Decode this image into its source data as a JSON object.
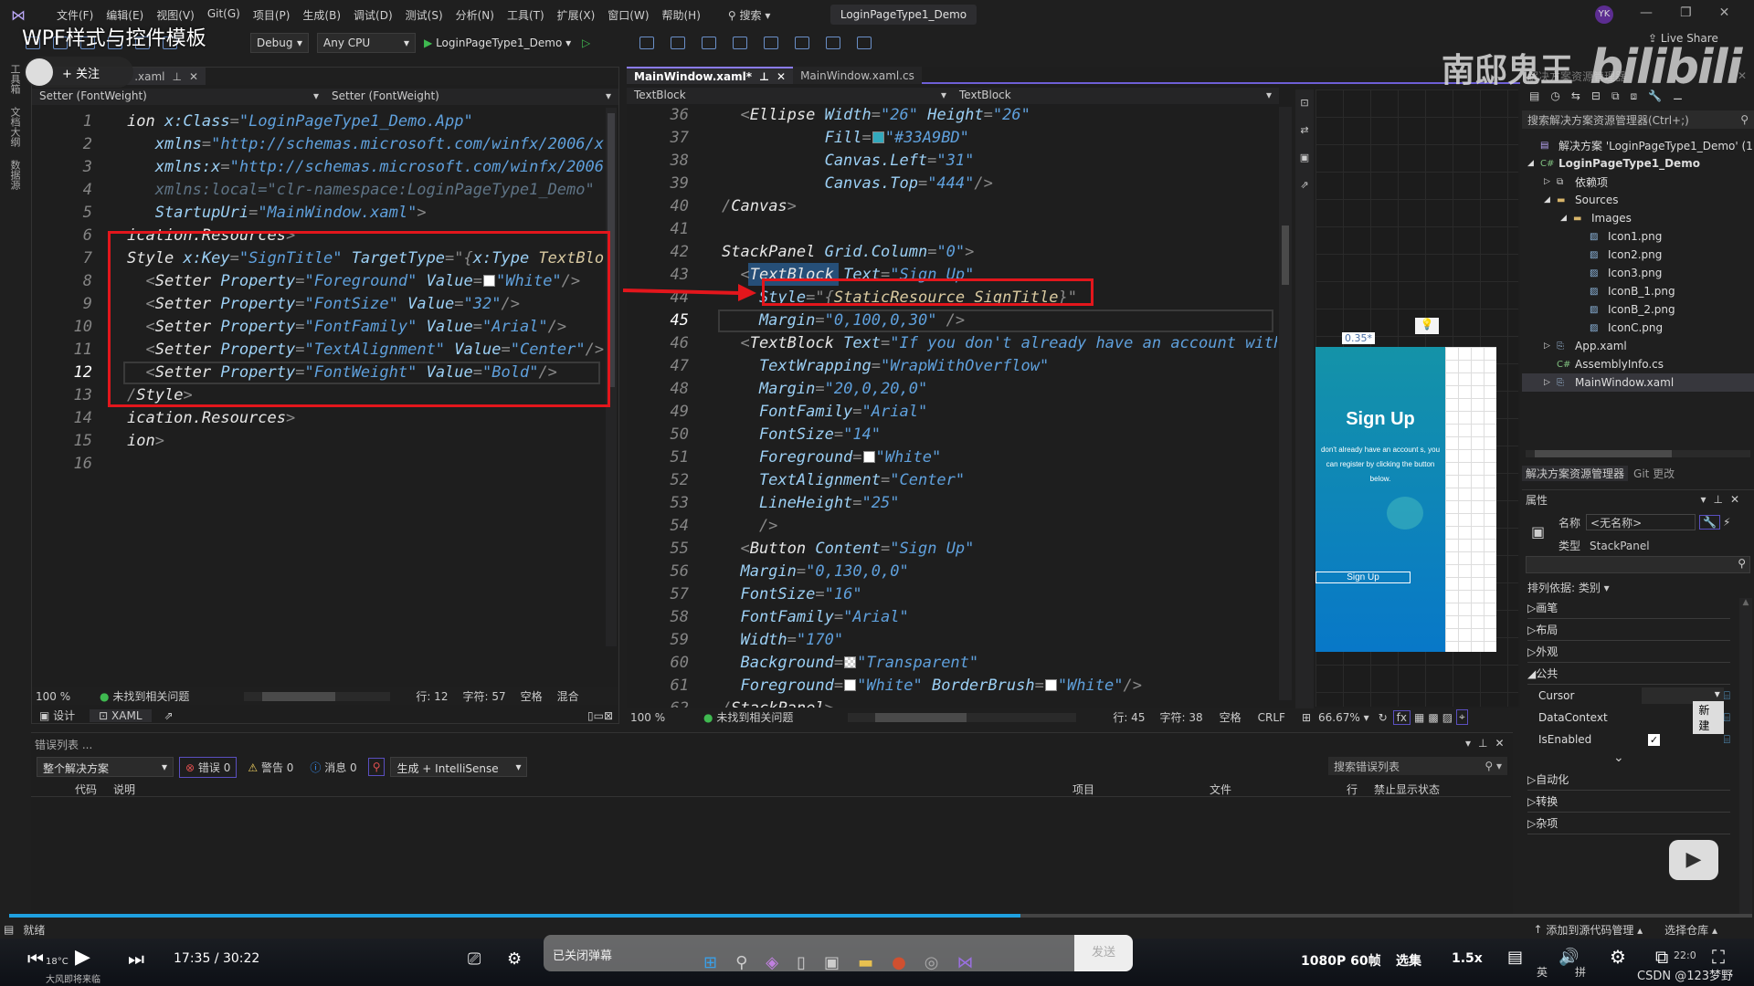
{
  "overlay": {
    "video_title": "WPF样式与控件模板",
    "follow": "+ 关注",
    "watermark_cn": "南邸鬼王",
    "watermark_logo": "bilibili",
    "csdn": "CSDN @123梦野"
  },
  "menubar": {
    "items": [
      "文件(F)",
      "编辑(E)",
      "视图(V)",
      "Git(G)",
      "项目(P)",
      "生成(B)",
      "调试(D)",
      "测试(S)",
      "分析(N)",
      "工具(T)",
      "扩展(X)",
      "窗口(W)",
      "帮助(H)"
    ],
    "search": "搜索",
    "title": "LoginPageType1_Demo",
    "user": "YK",
    "live_share": "Live Share"
  },
  "toolbar": {
    "config": "Debug",
    "platform": "Any CPU",
    "run_target": "LoginPageType1_Demo"
  },
  "left_strip": [
    "工具箱",
    "文档大纲",
    "数据源"
  ],
  "left_editor": {
    "tab": ".xaml",
    "nav": [
      "Setter (FontWeight)",
      "Setter (FontWeight)"
    ],
    "current_line": 12,
    "lines": [
      {
        "n": 1,
        "tokens": [
          [
            "t",
            "ion "
          ],
          [
            "a",
            "x:Class"
          ],
          [
            "p",
            "="
          ],
          [
            "v",
            "\"LoginPageType1_Demo.App\""
          ]
        ]
      },
      {
        "n": 2,
        "tokens": [
          [
            "a",
            "   xmlns"
          ],
          [
            "p",
            "="
          ],
          [
            "v",
            "\"http://schemas.microsoft.com/winfx/2006/xa"
          ]
        ]
      },
      {
        "n": 3,
        "tokens": [
          [
            "a",
            "   xmlns:x"
          ],
          [
            "p",
            "="
          ],
          [
            "v",
            "\"http://schemas.microsoft.com/winfx/2006/"
          ]
        ]
      },
      {
        "n": 4,
        "tokens": [
          [
            "g",
            "   xmlns:local=\"clr-namespace:LoginPageType1_Demo\""
          ]
        ]
      },
      {
        "n": 5,
        "tokens": [
          [
            "a",
            "   StartupUri"
          ],
          [
            "p",
            "="
          ],
          [
            "v",
            "\"MainWindow.xaml\""
          ],
          [
            "p",
            ">"
          ]
        ]
      },
      {
        "n": 6,
        "tokens": [
          [
            "t",
            "ication.Resources"
          ],
          [
            "p",
            ">"
          ]
        ]
      },
      {
        "n": 7,
        "tokens": [
          [
            "t",
            "Style "
          ],
          [
            "a",
            "x:Key"
          ],
          [
            "p",
            "="
          ],
          [
            "v",
            "\"SignTitle\" "
          ],
          [
            "a",
            "TargetType"
          ],
          [
            "p",
            "=\"{"
          ],
          [
            "a",
            "x:Type "
          ],
          [
            "k",
            "TextBlock"
          ]
        ]
      },
      {
        "n": 8,
        "tokens": [
          [
            "p",
            "  <"
          ],
          [
            "t",
            "Setter "
          ],
          [
            "a",
            "Property"
          ],
          [
            "p",
            "="
          ],
          [
            "v",
            "\"Foreground\" "
          ],
          [
            "a",
            "Value"
          ],
          [
            "p",
            "="
          ],
          [
            "s",
            "#FFFFFF"
          ],
          [
            "v",
            "\"White\""
          ],
          [
            "p",
            "/>"
          ]
        ]
      },
      {
        "n": 9,
        "tokens": [
          [
            "p",
            "  <"
          ],
          [
            "t",
            "Setter "
          ],
          [
            "a",
            "Property"
          ],
          [
            "p",
            "="
          ],
          [
            "v",
            "\"FontSize\" "
          ],
          [
            "a",
            "Value"
          ],
          [
            "p",
            "="
          ],
          [
            "v",
            "\"32\""
          ],
          [
            "p",
            "/>"
          ]
        ]
      },
      {
        "n": 10,
        "tokens": [
          [
            "p",
            "  <"
          ],
          [
            "t",
            "Setter "
          ],
          [
            "a",
            "Property"
          ],
          [
            "p",
            "="
          ],
          [
            "v",
            "\"FontFamily\" "
          ],
          [
            "a",
            "Value"
          ],
          [
            "p",
            "="
          ],
          [
            "v",
            "\"Arial\""
          ],
          [
            "p",
            "/>"
          ]
        ]
      },
      {
        "n": 11,
        "tokens": [
          [
            "p",
            "  <"
          ],
          [
            "t",
            "Setter "
          ],
          [
            "a",
            "Property"
          ],
          [
            "p",
            "="
          ],
          [
            "v",
            "\"TextAlignment\" "
          ],
          [
            "a",
            "Value"
          ],
          [
            "p",
            "="
          ],
          [
            "v",
            "\"Center\""
          ],
          [
            "p",
            "/>"
          ]
        ]
      },
      {
        "n": 12,
        "tokens": [
          [
            "p",
            "  <"
          ],
          [
            "t",
            "Setter "
          ],
          [
            "a",
            "Property"
          ],
          [
            "p",
            "="
          ],
          [
            "v",
            "\"FontWeight\" "
          ],
          [
            "a",
            "Value"
          ],
          [
            "p",
            "="
          ],
          [
            "v",
            "\"Bold\""
          ],
          [
            "p",
            "/>"
          ]
        ]
      },
      {
        "n": 13,
        "tokens": [
          [
            "p",
            "/"
          ],
          [
            "t",
            "Style"
          ],
          [
            "p",
            ">"
          ]
        ]
      },
      {
        "n": 14,
        "tokens": [
          [
            "t",
            "ication.Resources"
          ],
          [
            "p",
            ">"
          ]
        ]
      },
      {
        "n": 15,
        "tokens": [
          [
            "t",
            "ion"
          ],
          [
            "p",
            ">"
          ]
        ]
      },
      {
        "n": 16,
        "tokens": []
      }
    ],
    "status": {
      "zoom": "100 %",
      "issues": "未找到相关问题",
      "line": "行: 12",
      "char": "字符: 57",
      "spaces": "空格",
      "eol": "混合"
    },
    "view_tabs": {
      "design": "设计",
      "xaml": "XAML"
    }
  },
  "right_editor": {
    "tabs": [
      {
        "label": "MainWindow.xaml*",
        "active": true
      },
      {
        "label": "MainWindow.xaml.cs",
        "active": false
      }
    ],
    "nav": [
      "TextBlock",
      "TextBlock"
    ],
    "current_line": 45,
    "lines": [
      {
        "n": 36,
        "tokens": [
          [
            "p",
            "  <"
          ],
          [
            "t",
            "Ellipse "
          ],
          [
            "a",
            "Width"
          ],
          [
            "p",
            "="
          ],
          [
            "v",
            "\"26\" "
          ],
          [
            "a",
            "Height"
          ],
          [
            "p",
            "="
          ],
          [
            "v",
            "\"26\""
          ]
        ]
      },
      {
        "n": 37,
        "tokens": [
          [
            "a",
            "           Fill"
          ],
          [
            "p",
            "="
          ],
          [
            "s",
            "#33A9BD"
          ],
          [
            "v",
            "\"#33A9BD\""
          ]
        ]
      },
      {
        "n": 38,
        "tokens": [
          [
            "a",
            "           Canvas.Left"
          ],
          [
            "p",
            "="
          ],
          [
            "v",
            "\"31\""
          ]
        ]
      },
      {
        "n": 39,
        "tokens": [
          [
            "a",
            "           Canvas.Top"
          ],
          [
            "p",
            "="
          ],
          [
            "v",
            "\"444\""
          ],
          [
            "p",
            "/>"
          ]
        ]
      },
      {
        "n": 40,
        "tokens": [
          [
            "p",
            "/"
          ],
          [
            "t",
            "Canvas"
          ],
          [
            "p",
            ">"
          ]
        ]
      },
      {
        "n": 41,
        "tokens": []
      },
      {
        "n": 42,
        "tokens": [
          [
            "t",
            "StackPanel "
          ],
          [
            "a",
            "Grid.Column"
          ],
          [
            "p",
            "="
          ],
          [
            "v",
            "\"0\""
          ],
          [
            "p",
            ">"
          ]
        ]
      },
      {
        "n": 43,
        "tokens": [
          [
            "p",
            "  <"
          ],
          [
            "t",
            "TextBlock "
          ],
          [
            "a",
            "Text"
          ],
          [
            "p",
            "="
          ],
          [
            "v",
            "\"Sign Up\""
          ]
        ]
      },
      {
        "n": 44,
        "tokens": [
          [
            "a",
            "    Style"
          ],
          [
            "p",
            "=\"{"
          ],
          [
            "k",
            "StaticResource SignTitle"
          ],
          [
            "p",
            "}\""
          ]
        ]
      },
      {
        "n": 45,
        "tokens": [
          [
            "a",
            "    Margin"
          ],
          [
            "p",
            "="
          ],
          [
            "v",
            "\"0,100,0,30\" "
          ],
          [
            "p",
            "/>"
          ]
        ]
      },
      {
        "n": 46,
        "tokens": [
          [
            "p",
            "  <"
          ],
          [
            "t",
            "TextBlock "
          ],
          [
            "a",
            "Text"
          ],
          [
            "p",
            "="
          ],
          [
            "v",
            "\"If you don't already have an account with"
          ]
        ]
      },
      {
        "n": 47,
        "tokens": [
          [
            "a",
            "    TextWrapping"
          ],
          [
            "p",
            "="
          ],
          [
            "v",
            "\"WrapWithOverflow\""
          ]
        ]
      },
      {
        "n": 48,
        "tokens": [
          [
            "a",
            "    Margin"
          ],
          [
            "p",
            "="
          ],
          [
            "v",
            "\"20,0,20,0\""
          ]
        ]
      },
      {
        "n": 49,
        "tokens": [
          [
            "a",
            "    FontFamily"
          ],
          [
            "p",
            "="
          ],
          [
            "v",
            "\"Arial\""
          ]
        ]
      },
      {
        "n": 50,
        "tokens": [
          [
            "a",
            "    FontSize"
          ],
          [
            "p",
            "="
          ],
          [
            "v",
            "\"14\""
          ]
        ]
      },
      {
        "n": 51,
        "tokens": [
          [
            "a",
            "    Foreground"
          ],
          [
            "p",
            "="
          ],
          [
            "s",
            "#FFFFFF"
          ],
          [
            "v",
            "\"White\""
          ]
        ]
      },
      {
        "n": 52,
        "tokens": [
          [
            "a",
            "    TextAlignment"
          ],
          [
            "p",
            "="
          ],
          [
            "v",
            "\"Center\""
          ]
        ]
      },
      {
        "n": 53,
        "tokens": [
          [
            "a",
            "    LineHeight"
          ],
          [
            "p",
            "="
          ],
          [
            "v",
            "\"25\""
          ]
        ]
      },
      {
        "n": 54,
        "tokens": [
          [
            "p",
            "    />"
          ]
        ]
      },
      {
        "n": 55,
        "tokens": [
          [
            "p",
            "  <"
          ],
          [
            "t",
            "Button "
          ],
          [
            "a",
            "Content"
          ],
          [
            "p",
            "="
          ],
          [
            "v",
            "\"Sign Up\""
          ]
        ]
      },
      {
        "n": 56,
        "tokens": [
          [
            "a",
            "  Margin"
          ],
          [
            "p",
            "="
          ],
          [
            "v",
            "\"0,130,0,0\""
          ]
        ]
      },
      {
        "n": 57,
        "tokens": [
          [
            "a",
            "  FontSize"
          ],
          [
            "p",
            "="
          ],
          [
            "v",
            "\"16\""
          ]
        ]
      },
      {
        "n": 58,
        "tokens": [
          [
            "a",
            "  FontFamily"
          ],
          [
            "p",
            "="
          ],
          [
            "v",
            "\"Arial\""
          ]
        ]
      },
      {
        "n": 59,
        "tokens": [
          [
            "a",
            "  Width"
          ],
          [
            "p",
            "="
          ],
          [
            "v",
            "\"170\""
          ]
        ]
      },
      {
        "n": 60,
        "tokens": [
          [
            "a",
            "  Background"
          ],
          [
            "p",
            "="
          ],
          [
            "s",
            "transparent"
          ],
          [
            "v",
            "\"Transparent\""
          ]
        ]
      },
      {
        "n": 61,
        "tokens": [
          [
            "a",
            "  Foreground"
          ],
          [
            "p",
            "="
          ],
          [
            "s",
            "#FFFFFF"
          ],
          [
            "v",
            "\"White\" "
          ],
          [
            "a",
            "BorderBrush"
          ],
          [
            "p",
            "="
          ],
          [
            "s",
            "#FFFFFF"
          ],
          [
            "v",
            "\"White\""
          ],
          [
            "p",
            "/>"
          ]
        ]
      },
      {
        "n": 62,
        "tokens": [
          [
            "p",
            "/"
          ],
          [
            "t",
            "StackPanel"
          ],
          [
            "p",
            ">"
          ]
        ]
      }
    ],
    "status": {
      "zoom": "100 %",
      "issues": "未找到相关问题",
      "line": "行: 45",
      "char": "字符: 38",
      "spaces": "空格",
      "eol": "CRLF",
      "designer_zoom": "66.67%"
    }
  },
  "designer": {
    "grid_label": "0.35*",
    "title": "Sign Up",
    "body": "don't already have an account s, you can register by clicking the button below.",
    "button": "Sign Up",
    "accent": "#33A9BD"
  },
  "solution_explorer": {
    "title": "解决方案资源管理器",
    "search_placeholder": "搜索解决方案资源管理器(Ctrl+;)",
    "items": [
      {
        "label": "解决方案 'LoginPageType1_Demo' (1",
        "icon": "solution",
        "depth": 0,
        "exp": ""
      },
      {
        "label": "LoginPageType1_Demo",
        "icon": "csproj",
        "depth": 0,
        "exp": "◢",
        "bold": true
      },
      {
        "label": "依赖项",
        "icon": "deps",
        "depth": 1,
        "exp": "▷"
      },
      {
        "label": "Sources",
        "icon": "folder",
        "depth": 1,
        "exp": "◢"
      },
      {
        "label": "Images",
        "icon": "folder",
        "depth": 2,
        "exp": "◢"
      },
      {
        "label": "Icon1.png",
        "icon": "image",
        "depth": 3,
        "exp": ""
      },
      {
        "label": "Icon2.png",
        "icon": "image",
        "depth": 3,
        "exp": ""
      },
      {
        "label": "Icon3.png",
        "icon": "image",
        "depth": 3,
        "exp": ""
      },
      {
        "label": "IconB_1.png",
        "icon": "image",
        "depth": 3,
        "exp": ""
      },
      {
        "label": "IconB_2.png",
        "icon": "image",
        "depth": 3,
        "exp": ""
      },
      {
        "label": "IconC.png",
        "icon": "image",
        "depth": 3,
        "exp": ""
      },
      {
        "label": "App.xaml",
        "icon": "xaml",
        "depth": 1,
        "exp": "▷"
      },
      {
        "label": "AssemblyInfo.cs",
        "icon": "cs",
        "depth": 1,
        "exp": ""
      },
      {
        "label": "MainWindow.xaml",
        "icon": "xaml",
        "depth": 1,
        "exp": "▷",
        "selected": true
      }
    ],
    "bottom_tabs": [
      "解决方案资源管理器",
      "Git 更改"
    ]
  },
  "properties": {
    "title": "属性",
    "name_label": "名称",
    "name_value": "<无名称>",
    "type_label": "类型",
    "type_value": "StackPanel",
    "sort": "排列依据: 类别 ▾",
    "categories_top": [
      "画笔",
      "布局",
      "外观"
    ],
    "common": "公共",
    "rows": [
      {
        "label": "Cursor",
        "kind": "combo"
      },
      {
        "label": "DataContext",
        "kind": "button",
        "value": "新建"
      },
      {
        "label": "IsEnabled",
        "kind": "check",
        "checked": true
      }
    ],
    "categories_bottom": [
      "自动化",
      "转换",
      "杂项"
    ]
  },
  "error_list": {
    "title": "错误列表 ...",
    "scope": "整个解决方案",
    "errors": "错误 0",
    "warnings": "警告 0",
    "messages": "消息 0",
    "source": "生成 + IntelliSense",
    "search": "搜索错误列表",
    "columns": [
      "代码",
      "说明",
      "项目",
      "文件",
      "行",
      "禁止显示状态"
    ]
  },
  "statusbar": {
    "ready": "就绪",
    "source_control": "添加到源代码管理 ▴",
    "repo": "选择仓库 ▴"
  },
  "player": {
    "time": "17:35 / 30:22",
    "progress": 0.58,
    "danmaku": "已关闭弹幕",
    "send": "发送",
    "quality": "1080P 60帧",
    "episodes": "选集",
    "speed": "1.5x",
    "weather_temp": "18°C",
    "weather_text": "大风即将来临",
    "ime1": "英",
    "ime2": "拼",
    "clock": "22:0"
  }
}
